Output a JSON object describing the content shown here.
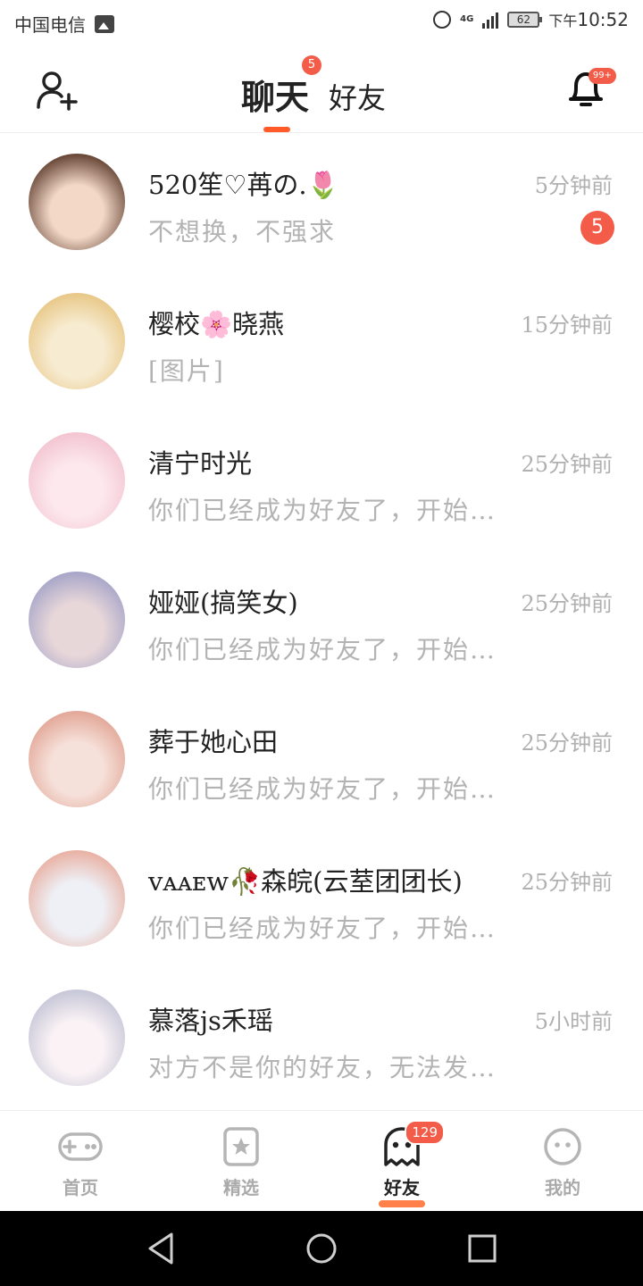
{
  "status_bar": {
    "carrier": "中国电信",
    "network": "4G",
    "battery": "62",
    "time_prefix": "下午",
    "time": "10:52"
  },
  "header": {
    "tab_chat": "聊天",
    "tab_chat_badge": "5",
    "tab_friends": "好友",
    "notifications_badge": "99+"
  },
  "chats": [
    {
      "name": "520笙♡苒の.🌷",
      "time": "5分钟前",
      "message": "不想换，不强求",
      "unread": "5",
      "avatar_colors": [
        "#6b4a3a",
        "#f3d8c8"
      ]
    },
    {
      "name": "樱校🌸晓燕",
      "time": "15分钟前",
      "message": "[图片]",
      "unread": "",
      "avatar_colors": [
        "#e9c98a",
        "#f7ecd2"
      ]
    },
    {
      "name": "清宁时光",
      "time": "25分钟前",
      "message": "你们已经成为好友了，开始…",
      "unread": "",
      "avatar_colors": [
        "#f3c6d2",
        "#fde8ee"
      ]
    },
    {
      "name": "娅娅(搞笑女)",
      "time": "25分钟前",
      "message": "你们已经成为好友了，开始…",
      "unread": "",
      "avatar_colors": [
        "#a9a7c9",
        "#e8d7d9"
      ]
    },
    {
      "name": "葬于她心田",
      "time": "25分钟前",
      "message": "你们已经成为好友了，开始…",
      "unread": "",
      "avatar_colors": [
        "#e3a99a",
        "#f6e1da"
      ]
    },
    {
      "name": "ᴠᴀᴀᴇᴡ🥀森皖(云荎团团长)",
      "time": "25分钟前",
      "message": "你们已经成为好友了，开始…",
      "unread": "",
      "avatar_colors": [
        "#e9b3a6",
        "#eef0f6"
      ]
    },
    {
      "name": "慕落js禾瑶",
      "time": "5小时前",
      "message": "对方不是你的好友，无法发…",
      "unread": "",
      "avatar_colors": [
        "#c8c8d8",
        "#faf2f5"
      ]
    }
  ],
  "bottom_nav": {
    "home": "首页",
    "featured": "精选",
    "friends": "好友",
    "friends_badge": "129",
    "me": "我的"
  },
  "colors": {
    "accent": "#ff5a28",
    "badge": "#f25c48",
    "muted_text": "#b3b3b3"
  }
}
